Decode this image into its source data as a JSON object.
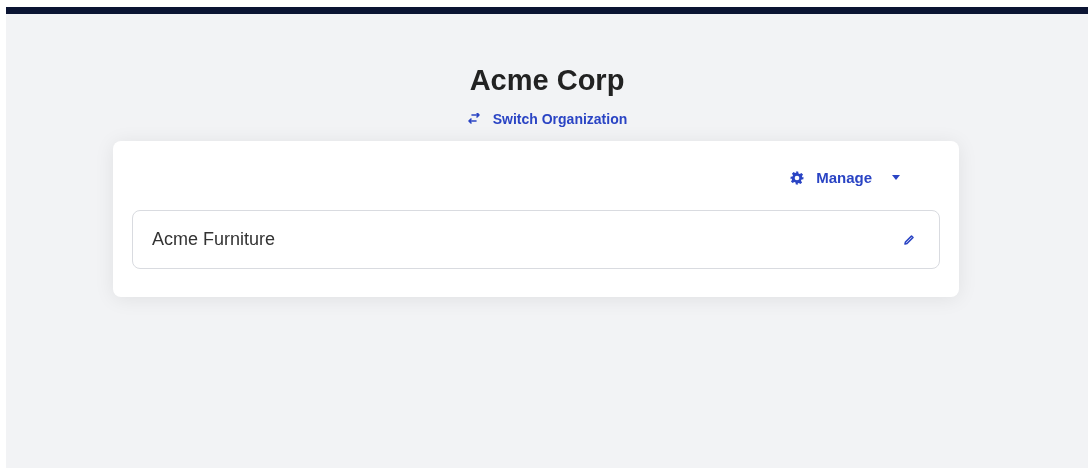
{
  "header": {
    "title": "Acme Corp",
    "switch_link": "Switch Organization"
  },
  "card": {
    "menu": {
      "label": "Manage",
      "expanded": false
    },
    "items": [
      {
        "name": "Acme Furniture"
      }
    ]
  }
}
